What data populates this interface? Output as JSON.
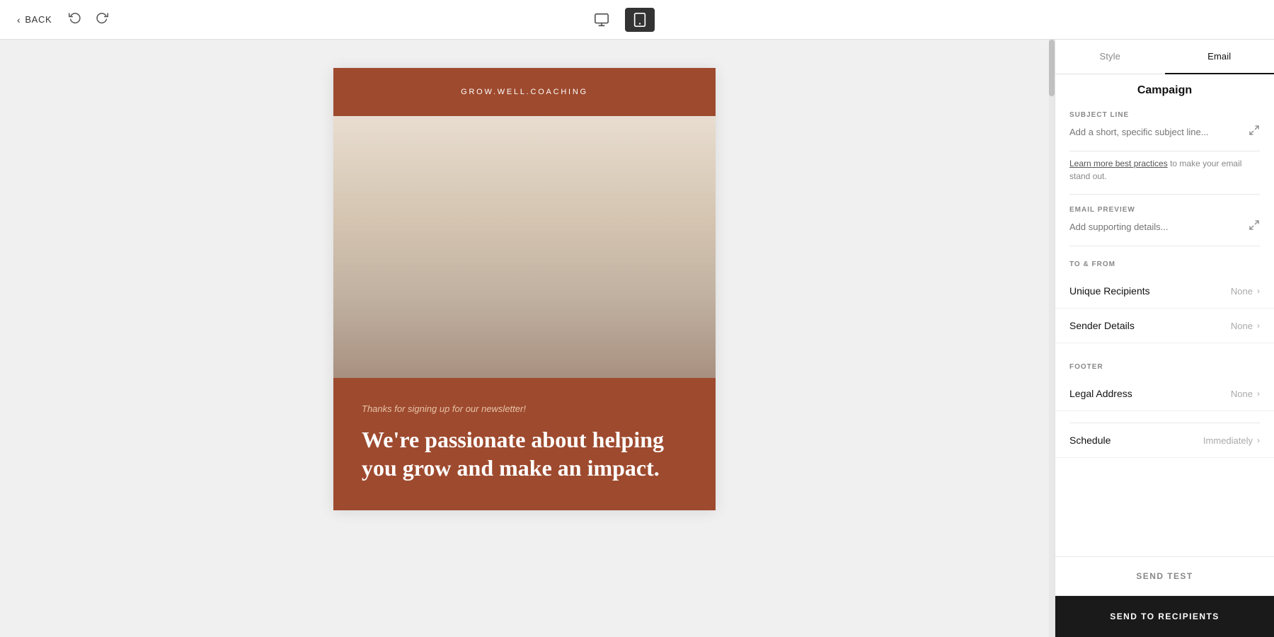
{
  "nav": {
    "back_label": "BACK",
    "undo_icon": "undo",
    "redo_icon": "redo",
    "device_desktop_label": "desktop",
    "device_tablet_label": "tablet"
  },
  "tabs": {
    "style_label": "Style",
    "email_label": "Email"
  },
  "panel": {
    "campaign_title": "Campaign",
    "subject_line_label": "SUBJECT LINE",
    "subject_line_placeholder": "Add a short, specific subject line...",
    "subject_line_icon": "expand-icon",
    "helper_text_link": "Learn more best practices",
    "helper_text_suffix": " to make your email stand out.",
    "email_preview_label": "EMAIL PREVIEW",
    "email_preview_placeholder": "Add supporting details...",
    "email_preview_icon": "expand-icon",
    "to_from_label": "TO & FROM",
    "unique_recipients_label": "Unique Recipients",
    "unique_recipients_value": "None",
    "sender_details_label": "Sender Details",
    "sender_details_value": "None",
    "footer_label": "FOOTER",
    "legal_address_label": "Legal Address",
    "legal_address_value": "None",
    "schedule_label": "Schedule",
    "schedule_value": "Immediately",
    "send_test_label": "SEND TEST",
    "send_recipients_label": "SEND TO RECIPIENTS"
  },
  "email": {
    "brand_name": "GROW.WELL.COACHING",
    "tagline": "Thanks for signing up for our newsletter!",
    "headline": "We're passionate about helping you grow and make an impact.",
    "header_bg": "#9e4a2e",
    "body_bg": "#9e4a2e"
  }
}
